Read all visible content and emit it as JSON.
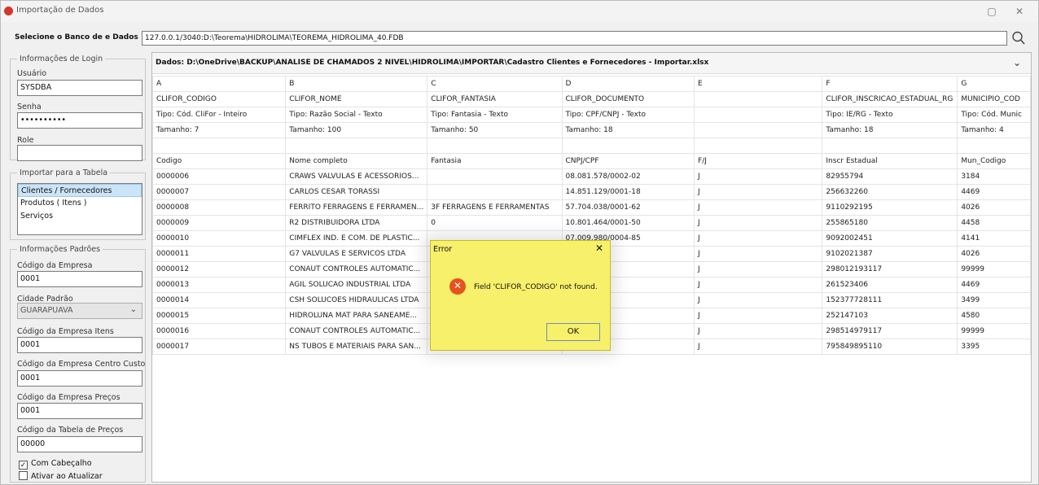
{
  "window": {
    "title": "Importação de Dados",
    "restore_glyph": "▢",
    "close_glyph": "✕"
  },
  "database": {
    "label": "Selecione o Banco de e Dados",
    "path": "127.0.0.1/3040:D:\\Teorema\\HIDROLIMA\\TEOREMA_HIDROLIMA_40.FDB"
  },
  "login": {
    "legend": "Informações de Login",
    "user_label": "Usuário",
    "user_value": "SYSDBA",
    "password_label": "Senha",
    "password_value": "••••••••••",
    "role_label": "Role",
    "role_value": ""
  },
  "import_table": {
    "legend": "Importar para a Tabela",
    "items": [
      "Clientes / Fornecedores",
      "Produtos ( Itens )",
      "Serviços"
    ],
    "selected": "Clientes / Fornecedores"
  },
  "defaults": {
    "legend": "Informações Padrões",
    "company_code_label": "Código da Empresa",
    "company_code_value": "0001",
    "city_label": "Cidade Padrão",
    "city_value": "GUARAPUAVA",
    "company_items_label": "Código da Empresa Itens",
    "company_items_value": "0001",
    "company_cost_center_label": "Código da Empresa Centro Custo",
    "company_cost_center_value": "0001",
    "company_prices_label": "Código da Empresa Preços",
    "company_prices_value": "0001",
    "price_table_label": "Código da Tabela de Preços",
    "price_table_value": "00000",
    "with_header_label": "Com Cabeçalho",
    "with_header_checked": true,
    "activate_on_update_label": "Ativar ao Atualizar",
    "activate_on_update_checked": false
  },
  "data_path": "Dados: D:\\OneDrive\\BACKUP\\ANALISE DE CHAMADOS 2 NIVEL\\HIDROLIMA\\IMPORTAR\\Cadastro Clientes e Fornecedores - Importar.xlsx",
  "sheet": {
    "columns": [
      "A",
      "B",
      "C",
      "D",
      "E",
      "F",
      "G"
    ],
    "field_names": [
      "CLIFOR_CODIGO",
      "CLIFOR_NOME",
      "CLIFOR_FANTASIA",
      "CLIFOR_DOCUMENTO",
      "",
      "CLIFOR_INSCRICAO_ESTADUAL_RG",
      "MUNICIPIO_COD"
    ],
    "types": [
      "Tipo: Cód. CliFor - Inteiro",
      "Tipo: Razão Social - Texto",
      "Tipo: Fantasia - Texto",
      "Tipo: CPF/CNPJ - Texto",
      "",
      "Tipo: IE/RG - Texto",
      "Tipo: Cód. Munic"
    ],
    "sizes": [
      "Tamanho: 7",
      "Tamanho: 100",
      "Tamanho: 50",
      "Tamanho: 18",
      "",
      "Tamanho: 18",
      "Tamanho: 4"
    ],
    "blank": [
      "",
      "",
      "",
      "",
      "",
      "",
      ""
    ],
    "headers": [
      "Codigo",
      "Nome completo",
      "Fantasia",
      "CNPJ/CPF",
      "F/J",
      "Inscr Estadual",
      "Mun_Codigo"
    ],
    "rows": [
      [
        "0000006",
        "CRAWS VALVULAS E ACESSORIOS...",
        "",
        "08.081.578/0002-02",
        "J",
        "82955794",
        "3184"
      ],
      [
        "0000007",
        "CARLOS CESAR TORASSI",
        "",
        "14.851.129/0001-18",
        "J",
        "256632260",
        "4469"
      ],
      [
        "0000008",
        "FERRITO FERRAGENS E FERRAMEN...",
        "3F FERRAGENS E FERRAMENTAS",
        "57.704.038/0001-62",
        "J",
        "9110292195",
        "4026"
      ],
      [
        "0000009",
        "R2 DISTRIBUIDORA LTDA",
        "0",
        "10.801.464/0001-50",
        "J",
        "255865180",
        "4458"
      ],
      [
        "0000010",
        "CIMFLEX IND. E COM. DE PLASTIC...",
        "",
        "07.009.980/0004-85",
        "J",
        "9092002451",
        "4141"
      ],
      [
        "0000011",
        "G7 VALVULAS E SERVICOS LTDA",
        "F",
        "001-47",
        "J",
        "9102021387",
        "4026"
      ],
      [
        "0000012",
        "CONAUT CONTROLES AUTOMATIC...",
        "R",
        "001-46",
        "J",
        "298012193117",
        "99999"
      ],
      [
        "0000013",
        "AGIL SOLUCAO INDUSTRIAL LTDA",
        "",
        "001-80",
        "J",
        "261523406",
        "4469"
      ],
      [
        "0000014",
        "CSH SOLUCOES HIDRAULICAS LTDA",
        "C",
        "001-27",
        "J",
        "152377728111",
        "3499"
      ],
      [
        "0000015",
        "HIDROLUNA MAT PARA SANEAME...",
        "",
        "001-48",
        "J",
        "252147103",
        "4580"
      ],
      [
        "0000016",
        "CONAUT CONTROLES AUTOMATIC...",
        "",
        "001-10",
        "J",
        "298514979117",
        "99999"
      ],
      [
        "0000017",
        "NS TUBOS E MATERIAIS PARA SAN...",
        "N",
        "001-66",
        "J",
        "795849895110",
        "3395"
      ]
    ]
  },
  "dialog": {
    "title": "Error",
    "message": "Field 'CLIFOR_CODIGO' not found.",
    "ok_label": "OK",
    "close_glyph": "✕"
  },
  "colors": {
    "dialog_bg": "#f7f06b",
    "error_icon": "#e5531e",
    "selection": "#cce4f7"
  }
}
